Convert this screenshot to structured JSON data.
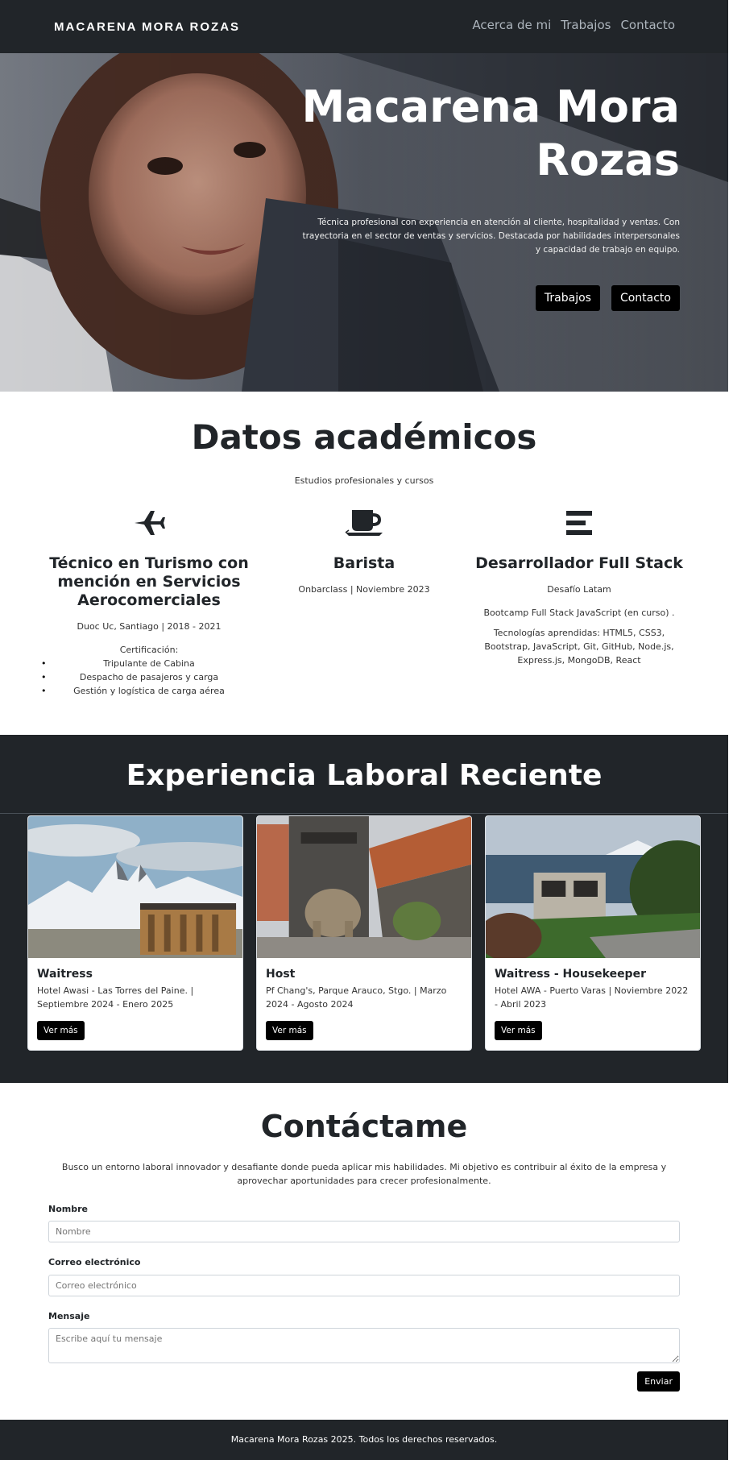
{
  "nav": {
    "brand": "MACARENA MORA ROZAS",
    "links": [
      "Acerca de mi",
      "Trabajos",
      "Contacto"
    ]
  },
  "hero": {
    "title": "Macarena Mora Rozas",
    "description": "Técnica profesional con experiencia en atención al cliente, hospitalidad y ventas. Con trayectoria en el sector de ventas y servicios. Destacada por habilidades interpersonales y capacidad de trabajo en equipo.",
    "buttons": [
      "Trabajos",
      "Contacto"
    ]
  },
  "academics": {
    "title": "Datos académicos",
    "subtitle": "Estudios profesionales y cursos",
    "items": [
      {
        "icon": "plane-icon",
        "title": "Técnico en Turismo con mención en Servicios Aerocomerciales",
        "place": "Duoc Uc, Santiago | 2018 - 2021",
        "cert_label": "Certificación:",
        "cert_items": [
          "Tripulante de Cabina",
          "Despacho de pasajeros y carga",
          "Gestión y logística de carga aérea"
        ]
      },
      {
        "icon": "coffee-cup-icon",
        "title": "Barista",
        "place": "Onbarclass | Noviembre 2023"
      },
      {
        "icon": "stack-bars-icon",
        "title": "Desarrollador Full Stack",
        "place": "Desafío Latam",
        "detail": "Bootcamp Full Stack JavaScript (en curso) .",
        "tech": "Tecnologías aprendidas: HTML5, CSS3, Bootstrap, JavaScript, Git, GitHub, Node.js, Express.js, MongoDB, React"
      }
    ]
  },
  "experience": {
    "title": "Experiencia Laboral Reciente",
    "cards": [
      {
        "title": "Waitress",
        "text": "Hotel Awasi - Las Torres del Paine. | Septiembre 2024 - Enero 2025",
        "button": "Ver más"
      },
      {
        "title": "Host",
        "text": "Pf Chang's, Parque Arauco, Stgo. | Marzo 2024 - Agosto 2024",
        "button": "Ver más"
      },
      {
        "title": "Waitress - Housekeeper",
        "text": "Hotel AWA - Puerto Varas | Noviembre 2022 - Abril 2023",
        "button": "Ver más"
      }
    ]
  },
  "contact": {
    "title": "Contáctame",
    "description": "Busco un entorno laboral innovador y desafiante donde pueda aplicar mis habilidades. Mi objetivo es contribuir al éxito de la empresa y aprovechar aportunidades para crecer profesionalmente.",
    "name_label": "Nombre",
    "name_placeholder": "Nombre",
    "email_label": "Correo electrónico",
    "email_placeholder": "Correo electrónico",
    "message_label": "Mensaje",
    "message_placeholder": "Escribe aquí tu mensaje",
    "submit": "Enviar"
  },
  "footer": {
    "text": "Macarena Mora Rozas 2025. Todos los derechos reservados."
  }
}
